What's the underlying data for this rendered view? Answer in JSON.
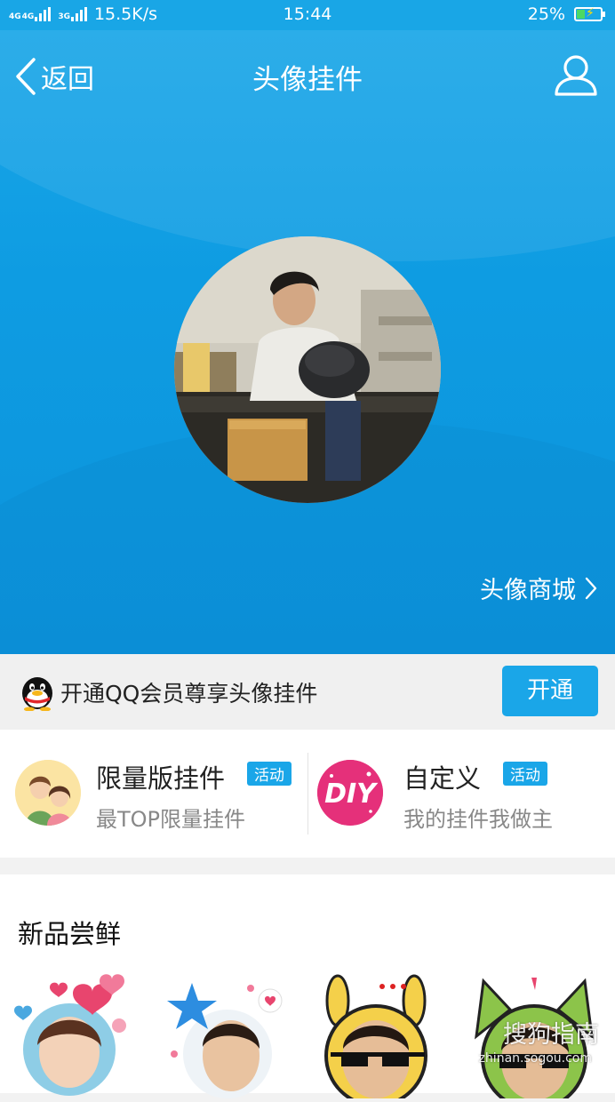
{
  "status_bar": {
    "network_label_1": "4G",
    "network_label_2": "4G",
    "network_label_3": "3G",
    "speed": "15.5K/s",
    "time": "15:44",
    "battery": "25%"
  },
  "nav": {
    "back_label": "返回",
    "title": "头像挂件",
    "profile_icon": "user-icon"
  },
  "hero": {
    "avatar_icon": "user-avatar-photo",
    "mall_link": "头像商城"
  },
  "vip_banner": {
    "text": "开通QQ会员尊享头像挂件",
    "button": "开通",
    "icon": "qq-penguin-icon"
  },
  "features": [
    {
      "title": "限量版挂件",
      "badge": "活动",
      "subtitle": "最TOP限量挂件",
      "icon": "couple-illustration-icon"
    },
    {
      "title": "自定义",
      "badge": "活动",
      "subtitle": "我的挂件我做主",
      "icon": "diy-icon"
    }
  ],
  "new_items": {
    "title": "新品尝鲜",
    "items": [
      {
        "name": "heart-balloon-frame"
      },
      {
        "name": "star-ribbon-frame"
      },
      {
        "name": "bunny-sunglasses-frame"
      },
      {
        "name": "cat-sunglasses-frame"
      }
    ]
  },
  "watermark": {
    "text": "搜狗指南",
    "url": "zhinan.sogou.com"
  },
  "colors": {
    "accent": "#1aa6e8",
    "hero_bg": "#0e9ce2",
    "badge": "#1aa6e8",
    "subtitle": "#888888"
  }
}
